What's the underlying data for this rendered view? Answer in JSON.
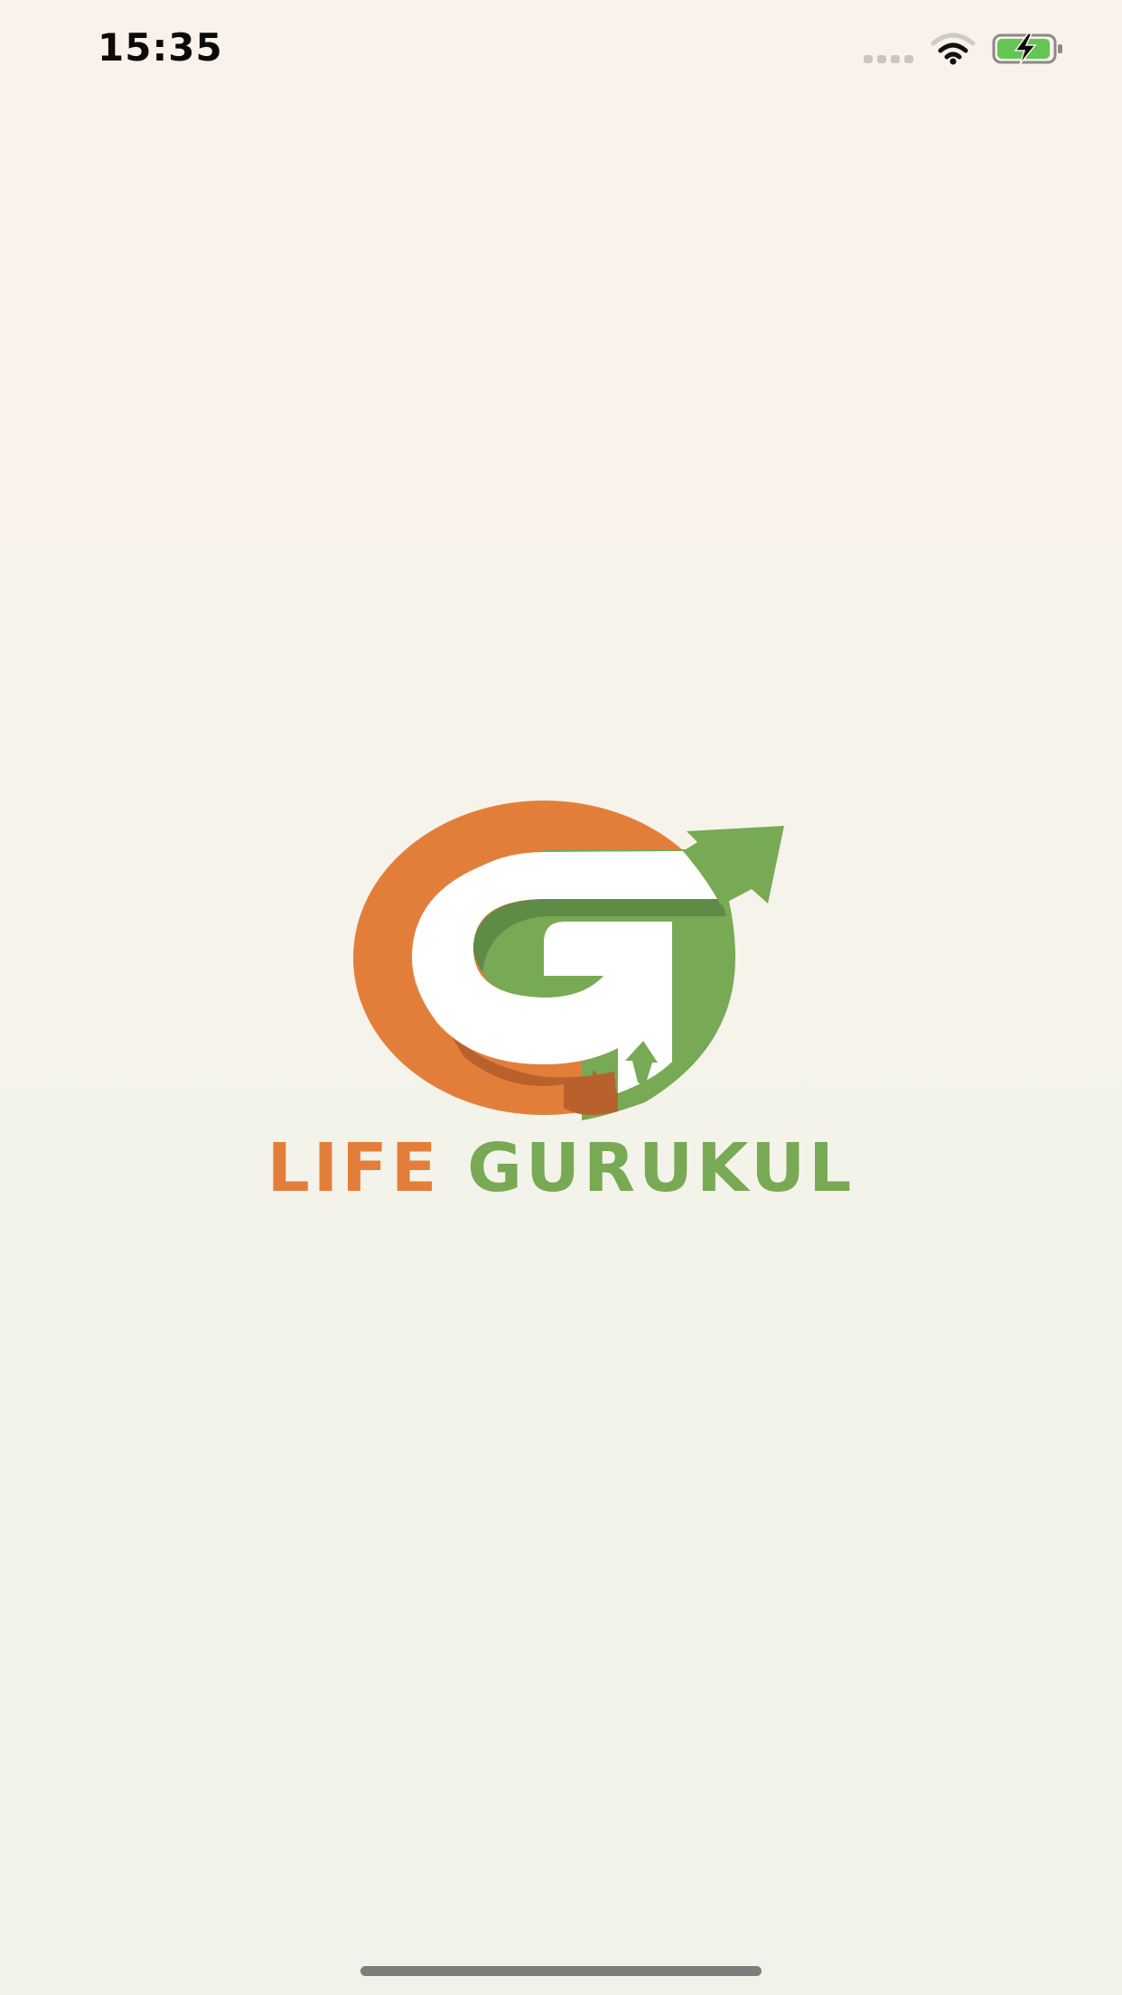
{
  "status_bar": {
    "time": "15:35",
    "signal_icon": "cellular-signal-icon",
    "wifi_icon": "wifi-icon",
    "battery_icon": "battery-charging-icon",
    "battery_level": 0.85
  },
  "splash": {
    "logo_icon": "life-gurukul-logo",
    "brand_word_1": "LIFE",
    "brand_word_2": "GURUKUL"
  },
  "colors": {
    "orange": "#e37e3a",
    "green": "#78a955",
    "dark_green": "#5e8b45",
    "dark_orange": "#b9612c",
    "battery_fill": "#62c554"
  }
}
